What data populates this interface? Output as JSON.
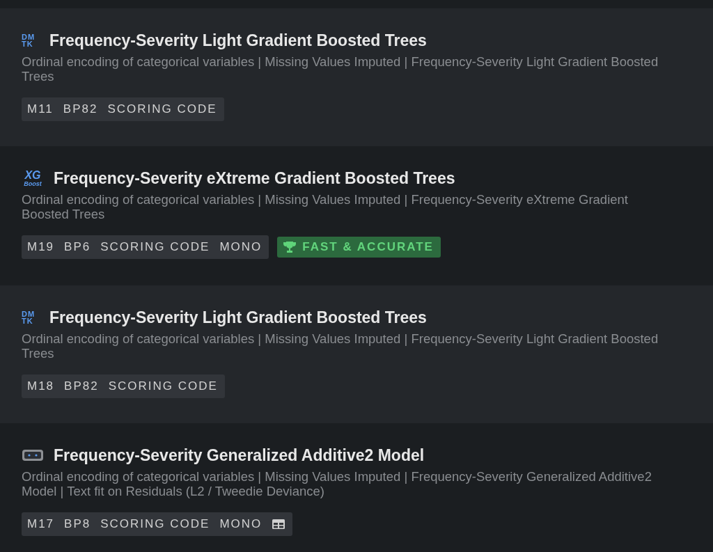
{
  "models": [
    {
      "logo": {
        "kind": "dmtk",
        "text": [
          "DM",
          "TK"
        ]
      },
      "title": "Frequency-Severity Light Gradient Boosted Trees",
      "description": "Ordinal encoding of categorical variables | Missing Values Imputed | Frequency-Severity Light Gradient Boosted Trees",
      "tags": [
        "M11",
        "BP82",
        "SCORING CODE"
      ]
    },
    {
      "logo": {
        "kind": "xgboost",
        "text": [
          "XG",
          "Boost"
        ]
      },
      "title": "Frequency-Severity eXtreme Gradient Boosted Trees",
      "description": "Ordinal encoding of categorical variables | Missing Values Imputed | Frequency-Severity eXtreme Gradient Boosted Trees",
      "tags": [
        "M19",
        "BP6",
        "SCORING CODE",
        "MONO"
      ],
      "badges": [
        {
          "kind": "trophy",
          "text": "FAST & ACCURATE"
        }
      ]
    },
    {
      "logo": {
        "kind": "dmtk",
        "text": [
          "DM",
          "TK"
        ]
      },
      "title": "Frequency-Severity Light Gradient Boosted Trees",
      "description": "Ordinal encoding of categorical variables | Missing Values Imputed | Frequency-Severity Light Gradient Boosted Trees",
      "tags": [
        "M18",
        "BP82",
        "SCORING CODE"
      ]
    },
    {
      "logo": {
        "kind": "robot"
      },
      "title": "Frequency-Severity Generalized Additive2 Model",
      "description": "Ordinal encoding of categorical variables | Missing Values Imputed | Frequency-Severity Generalized Additive2 Model | Text fit on Residuals (L2 / Tweedie Deviance)",
      "tags": [
        "M17",
        "BP8",
        "SCORING CODE",
        "MONO"
      ],
      "table_icon": true
    }
  ]
}
